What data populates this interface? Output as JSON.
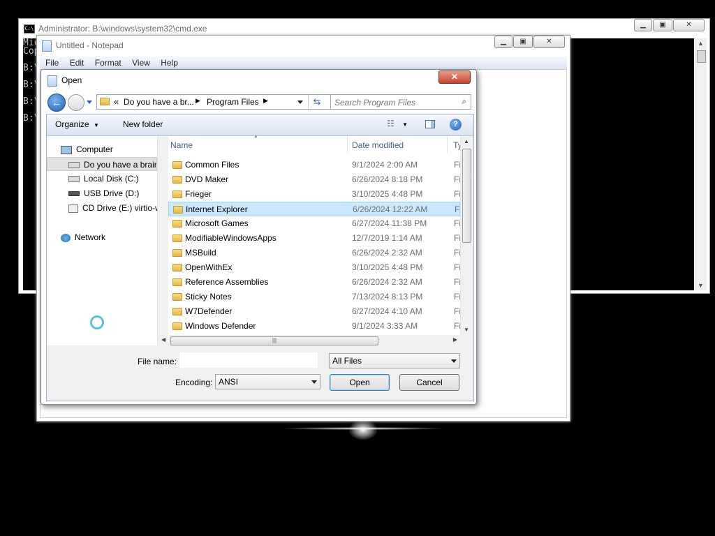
{
  "cmd": {
    "title": "Administrator: B:\\windows\\system32\\cmd.exe",
    "icon_text": "C:\\",
    "lines": [
      "Mic",
      "Cop",
      "B:\\",
      "B:\\",
      "B:\\",
      "B:\\"
    ]
  },
  "notepad": {
    "title": "Untitled - Notepad",
    "menu": [
      "File",
      "Edit",
      "Format",
      "View",
      "Help"
    ]
  },
  "dialog": {
    "title": "Open",
    "address": {
      "prefix": "«",
      "crumbs": [
        "Do you have a br...",
        "Program Files"
      ]
    },
    "search_placeholder": "Search Program Files",
    "toolbar": {
      "organize": "Organize",
      "new_folder": "New folder"
    },
    "nav": {
      "computer": "Computer",
      "drives": [
        "Do you have a brain",
        "Local Disk (C:)",
        "USB Drive (D:)",
        "CD Drive (E:) virtio-w"
      ],
      "network": "Network"
    },
    "columns": {
      "name": "Name",
      "date": "Date modified",
      "type": "Ty"
    },
    "files": [
      {
        "name": "Common Files",
        "date": "9/1/2024 2:00 AM",
        "type": "Fi"
      },
      {
        "name": "DVD Maker",
        "date": "6/26/2024 8:18 PM",
        "type": "Fi"
      },
      {
        "name": "Frieger",
        "date": "3/10/2025 4:48 PM",
        "type": "Fi"
      },
      {
        "name": "Internet Explorer",
        "date": "6/26/2024 12:22 AM",
        "type": "Fi"
      },
      {
        "name": "Microsoft Games",
        "date": "6/27/2024 11:38 PM",
        "type": "Fi"
      },
      {
        "name": "ModifiableWindowsApps",
        "date": "12/7/2019 1:14 AM",
        "type": "Fi"
      },
      {
        "name": "MSBuild",
        "date": "6/26/2024 2:32 AM",
        "type": "Fi"
      },
      {
        "name": "OpenWithEx",
        "date": "3/10/2025 4:48 PM",
        "type": "Fi"
      },
      {
        "name": "Reference Assemblies",
        "date": "6/26/2024 2:32 AM",
        "type": "Fi"
      },
      {
        "name": "Sticky Notes",
        "date": "7/13/2024 8:13 PM",
        "type": "Fi"
      },
      {
        "name": "W7Defender",
        "date": "6/27/2024 4:10 AM",
        "type": "Fi"
      },
      {
        "name": "Windows Defender",
        "date": "9/1/2024 3:33 AM",
        "type": "Fi"
      }
    ],
    "selected_file": "Internet Explorer",
    "file_name_label": "File name:",
    "file_name_value": "",
    "file_type": "All Files",
    "encoding_label": "Encoding:",
    "encoding_value": "ANSI",
    "open_button": "Open",
    "cancel_button": "Cancel"
  },
  "colors": {
    "selection": "#cce8ff",
    "selection_border": "#99d1ff",
    "close_red": "#c8452f"
  }
}
